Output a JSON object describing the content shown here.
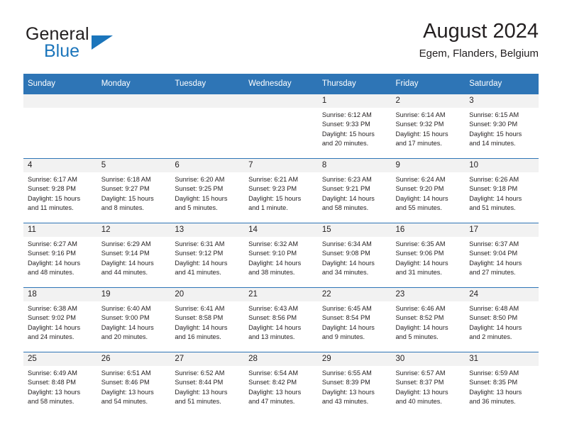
{
  "brand": {
    "name_part1": "General",
    "name_part2": "Blue",
    "logo_icon": "triangle-icon"
  },
  "header": {
    "title": "August 2024",
    "subtitle": "Egem, Flanders, Belgium"
  },
  "calendar": {
    "weekday_headers": [
      "Sunday",
      "Monday",
      "Tuesday",
      "Wednesday",
      "Thursday",
      "Friday",
      "Saturday"
    ],
    "accent_color": "#2e75b6",
    "daynum_bg": "#f2f2f2",
    "weeks": [
      [
        {
          "day": "",
          "empty": true
        },
        {
          "day": "",
          "empty": true
        },
        {
          "day": "",
          "empty": true
        },
        {
          "day": "",
          "empty": true
        },
        {
          "day": "1",
          "sunrise": "Sunrise: 6:12 AM",
          "sunset": "Sunset: 9:33 PM",
          "daylight1": "Daylight: 15 hours",
          "daylight2": "and 20 minutes."
        },
        {
          "day": "2",
          "sunrise": "Sunrise: 6:14 AM",
          "sunset": "Sunset: 9:32 PM",
          "daylight1": "Daylight: 15 hours",
          "daylight2": "and 17 minutes."
        },
        {
          "day": "3",
          "sunrise": "Sunrise: 6:15 AM",
          "sunset": "Sunset: 9:30 PM",
          "daylight1": "Daylight: 15 hours",
          "daylight2": "and 14 minutes."
        }
      ],
      [
        {
          "day": "4",
          "sunrise": "Sunrise: 6:17 AM",
          "sunset": "Sunset: 9:28 PM",
          "daylight1": "Daylight: 15 hours",
          "daylight2": "and 11 minutes."
        },
        {
          "day": "5",
          "sunrise": "Sunrise: 6:18 AM",
          "sunset": "Sunset: 9:27 PM",
          "daylight1": "Daylight: 15 hours",
          "daylight2": "and 8 minutes."
        },
        {
          "day": "6",
          "sunrise": "Sunrise: 6:20 AM",
          "sunset": "Sunset: 9:25 PM",
          "daylight1": "Daylight: 15 hours",
          "daylight2": "and 5 minutes."
        },
        {
          "day": "7",
          "sunrise": "Sunrise: 6:21 AM",
          "sunset": "Sunset: 9:23 PM",
          "daylight1": "Daylight: 15 hours",
          "daylight2": "and 1 minute."
        },
        {
          "day": "8",
          "sunrise": "Sunrise: 6:23 AM",
          "sunset": "Sunset: 9:21 PM",
          "daylight1": "Daylight: 14 hours",
          "daylight2": "and 58 minutes."
        },
        {
          "day": "9",
          "sunrise": "Sunrise: 6:24 AM",
          "sunset": "Sunset: 9:20 PM",
          "daylight1": "Daylight: 14 hours",
          "daylight2": "and 55 minutes."
        },
        {
          "day": "10",
          "sunrise": "Sunrise: 6:26 AM",
          "sunset": "Sunset: 9:18 PM",
          "daylight1": "Daylight: 14 hours",
          "daylight2": "and 51 minutes."
        }
      ],
      [
        {
          "day": "11",
          "sunrise": "Sunrise: 6:27 AM",
          "sunset": "Sunset: 9:16 PM",
          "daylight1": "Daylight: 14 hours",
          "daylight2": "and 48 minutes."
        },
        {
          "day": "12",
          "sunrise": "Sunrise: 6:29 AM",
          "sunset": "Sunset: 9:14 PM",
          "daylight1": "Daylight: 14 hours",
          "daylight2": "and 44 minutes."
        },
        {
          "day": "13",
          "sunrise": "Sunrise: 6:31 AM",
          "sunset": "Sunset: 9:12 PM",
          "daylight1": "Daylight: 14 hours",
          "daylight2": "and 41 minutes."
        },
        {
          "day": "14",
          "sunrise": "Sunrise: 6:32 AM",
          "sunset": "Sunset: 9:10 PM",
          "daylight1": "Daylight: 14 hours",
          "daylight2": "and 38 minutes."
        },
        {
          "day": "15",
          "sunrise": "Sunrise: 6:34 AM",
          "sunset": "Sunset: 9:08 PM",
          "daylight1": "Daylight: 14 hours",
          "daylight2": "and 34 minutes."
        },
        {
          "day": "16",
          "sunrise": "Sunrise: 6:35 AM",
          "sunset": "Sunset: 9:06 PM",
          "daylight1": "Daylight: 14 hours",
          "daylight2": "and 31 minutes."
        },
        {
          "day": "17",
          "sunrise": "Sunrise: 6:37 AM",
          "sunset": "Sunset: 9:04 PM",
          "daylight1": "Daylight: 14 hours",
          "daylight2": "and 27 minutes."
        }
      ],
      [
        {
          "day": "18",
          "sunrise": "Sunrise: 6:38 AM",
          "sunset": "Sunset: 9:02 PM",
          "daylight1": "Daylight: 14 hours",
          "daylight2": "and 24 minutes."
        },
        {
          "day": "19",
          "sunrise": "Sunrise: 6:40 AM",
          "sunset": "Sunset: 9:00 PM",
          "daylight1": "Daylight: 14 hours",
          "daylight2": "and 20 minutes."
        },
        {
          "day": "20",
          "sunrise": "Sunrise: 6:41 AM",
          "sunset": "Sunset: 8:58 PM",
          "daylight1": "Daylight: 14 hours",
          "daylight2": "and 16 minutes."
        },
        {
          "day": "21",
          "sunrise": "Sunrise: 6:43 AM",
          "sunset": "Sunset: 8:56 PM",
          "daylight1": "Daylight: 14 hours",
          "daylight2": "and 13 minutes."
        },
        {
          "day": "22",
          "sunrise": "Sunrise: 6:45 AM",
          "sunset": "Sunset: 8:54 PM",
          "daylight1": "Daylight: 14 hours",
          "daylight2": "and 9 minutes."
        },
        {
          "day": "23",
          "sunrise": "Sunrise: 6:46 AM",
          "sunset": "Sunset: 8:52 PM",
          "daylight1": "Daylight: 14 hours",
          "daylight2": "and 5 minutes."
        },
        {
          "day": "24",
          "sunrise": "Sunrise: 6:48 AM",
          "sunset": "Sunset: 8:50 PM",
          "daylight1": "Daylight: 14 hours",
          "daylight2": "and 2 minutes."
        }
      ],
      [
        {
          "day": "25",
          "sunrise": "Sunrise: 6:49 AM",
          "sunset": "Sunset: 8:48 PM",
          "daylight1": "Daylight: 13 hours",
          "daylight2": "and 58 minutes."
        },
        {
          "day": "26",
          "sunrise": "Sunrise: 6:51 AM",
          "sunset": "Sunset: 8:46 PM",
          "daylight1": "Daylight: 13 hours",
          "daylight2": "and 54 minutes."
        },
        {
          "day": "27",
          "sunrise": "Sunrise: 6:52 AM",
          "sunset": "Sunset: 8:44 PM",
          "daylight1": "Daylight: 13 hours",
          "daylight2": "and 51 minutes."
        },
        {
          "day": "28",
          "sunrise": "Sunrise: 6:54 AM",
          "sunset": "Sunset: 8:42 PM",
          "daylight1": "Daylight: 13 hours",
          "daylight2": "and 47 minutes."
        },
        {
          "day": "29",
          "sunrise": "Sunrise: 6:55 AM",
          "sunset": "Sunset: 8:39 PM",
          "daylight1": "Daylight: 13 hours",
          "daylight2": "and 43 minutes."
        },
        {
          "day": "30",
          "sunrise": "Sunrise: 6:57 AM",
          "sunset": "Sunset: 8:37 PM",
          "daylight1": "Daylight: 13 hours",
          "daylight2": "and 40 minutes."
        },
        {
          "day": "31",
          "sunrise": "Sunrise: 6:59 AM",
          "sunset": "Sunset: 8:35 PM",
          "daylight1": "Daylight: 13 hours",
          "daylight2": "and 36 minutes."
        }
      ]
    ]
  }
}
